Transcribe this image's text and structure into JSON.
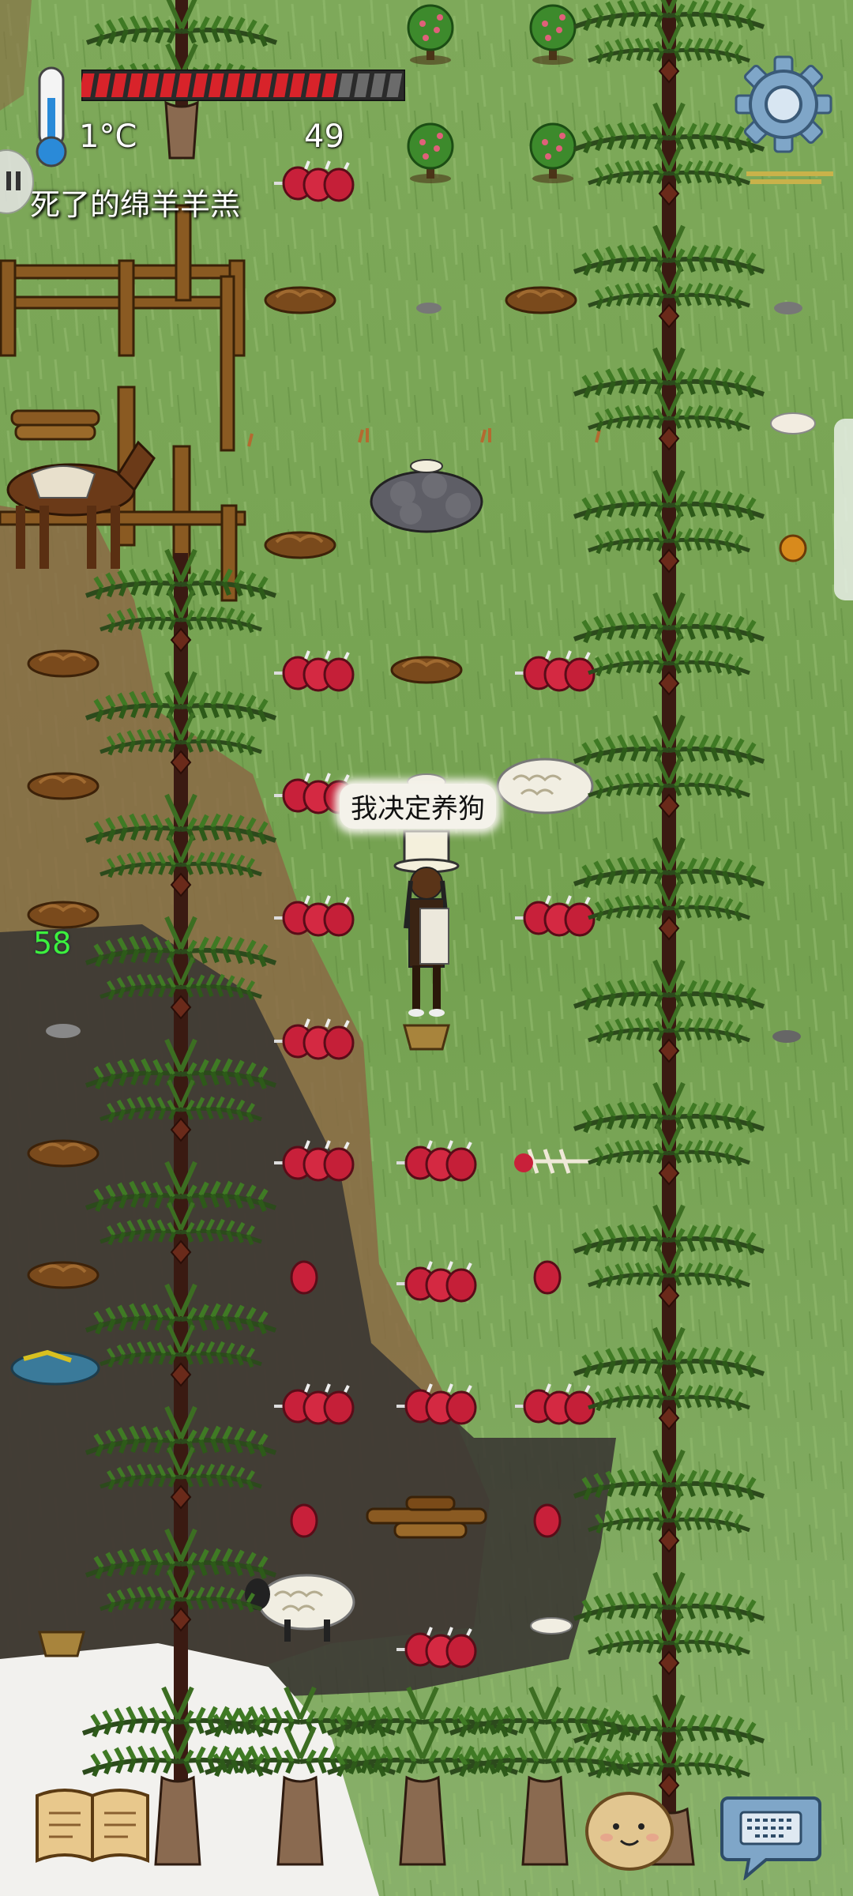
{
  "hud": {
    "temperature": "1°C",
    "age": "49",
    "food_filled_fraction": 0.8,
    "food_pips_total": 20,
    "hover_label": "死了的绵羊羊羔",
    "yum_bonus": "58"
  },
  "speech_bubble": "我决定养狗",
  "icons": {
    "thermometer": "thermometer-icon",
    "settings": "gear-icon",
    "tech_book": "book-icon",
    "emote": "emote-face-icon",
    "keyboard": "keyboard-icon"
  },
  "colors": {
    "grass": "#6f9a4c",
    "food_bar": "#d8232a",
    "yum_text": "#3df03d",
    "settings_gear": "#7fa6c8"
  }
}
